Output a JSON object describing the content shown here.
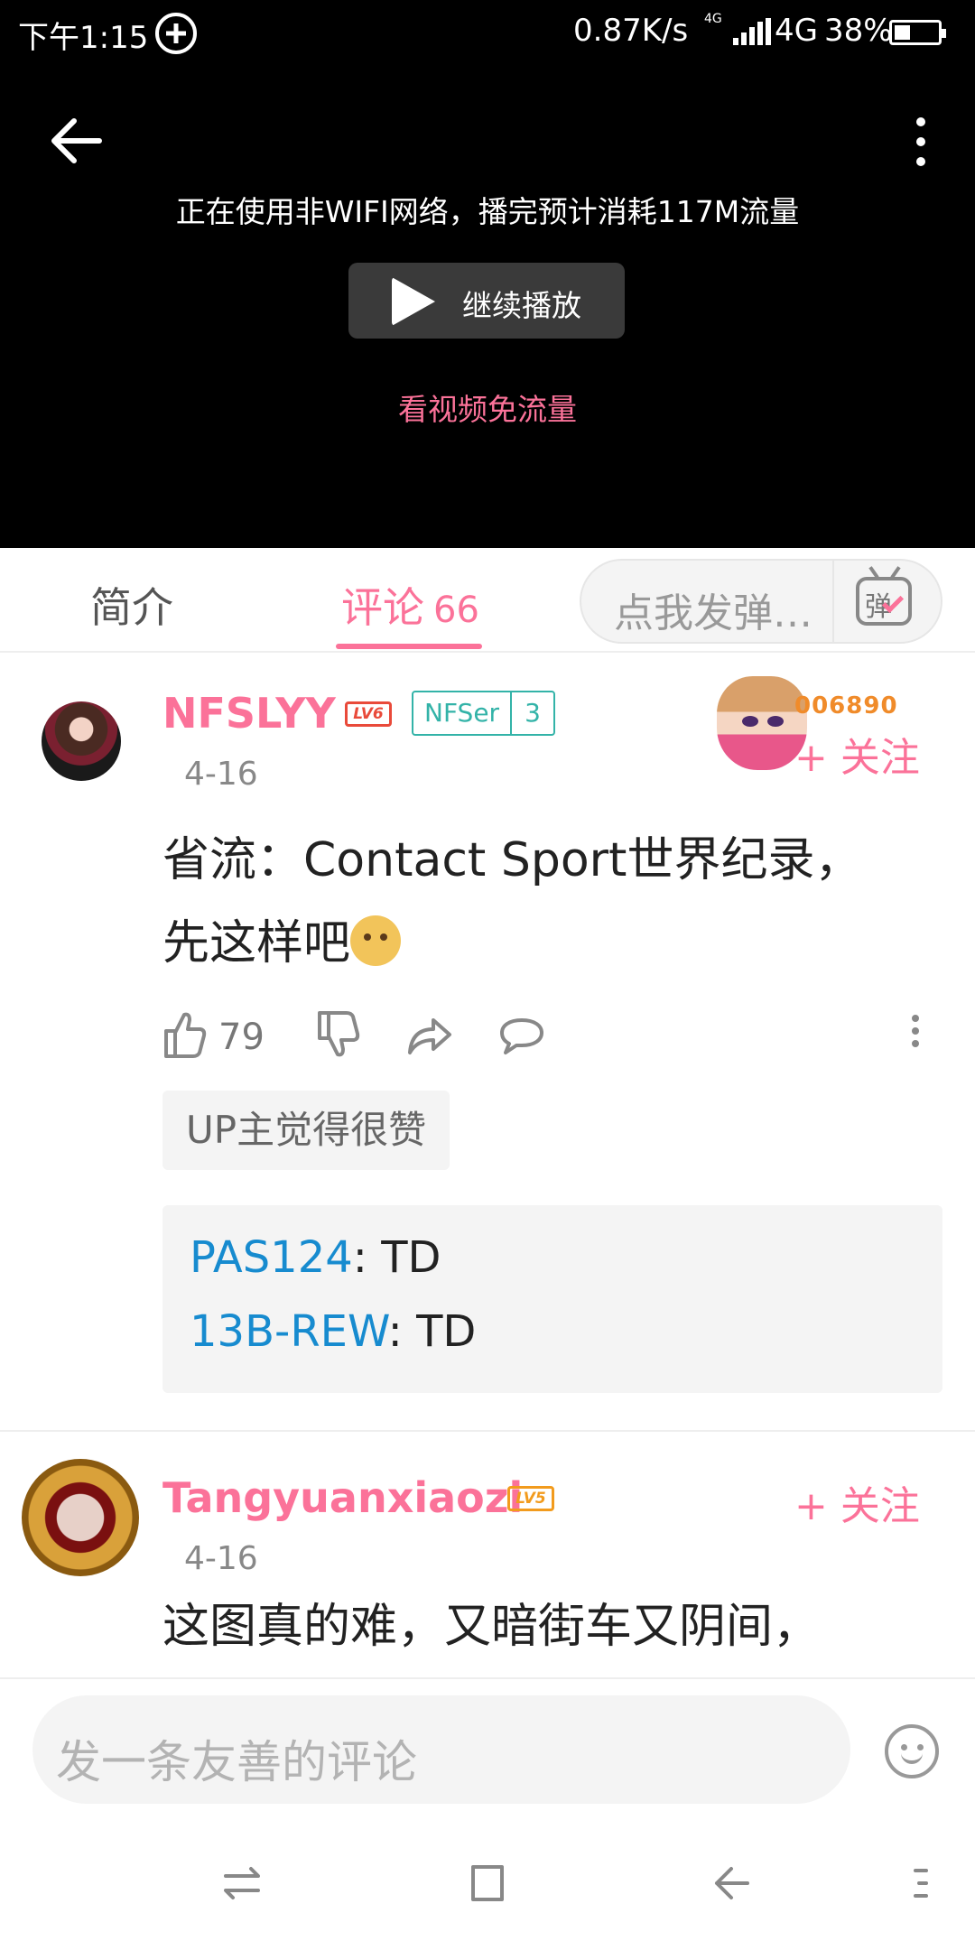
{
  "status_bar": {
    "time": "下午1:15",
    "speed": "0.87K/s",
    "net_small": "4G",
    "network": "4G",
    "battery": "38%",
    "battery_level": 0.38
  },
  "player": {
    "warning": "正在使用非WIFI网络，播完预计消耗117M流量",
    "play_label": "继续播放",
    "free_data_link": "看视频免流量"
  },
  "tabs": {
    "intro": "简介",
    "comments": "评论",
    "comment_count": "66",
    "danmaku_placeholder": "点我发弹…",
    "danmaku_icon_char": "弹"
  },
  "comments": [
    {
      "user": "NFSLYY",
      "level": "LV6",
      "medal_name": "NFSer",
      "medal_level": "3",
      "pendant_number": "006890",
      "date": "4-16",
      "follow": "+ 关注",
      "text_line1": "省流：Contact Sport世界纪录，",
      "text_line2": "先这样吧",
      "likes": "79",
      "up_badge": "UP主觉得很赞",
      "replies": [
        {
          "user": "PAS124",
          "text": ": TD"
        },
        {
          "user": "13B-REW",
          "text": ": TD"
        }
      ]
    },
    {
      "user": "Tangyuanxiaozi",
      "level": "LV5",
      "date": "4-16",
      "follow": "+ 关注",
      "text_line1": "这图真的难，又暗街车又阴间，"
    }
  ],
  "comment_input": {
    "placeholder": "发一条友善的评论"
  },
  "colors": {
    "accent": "#fb7299",
    "reply_user": "#178bcf",
    "medal": "#33b3a8"
  }
}
